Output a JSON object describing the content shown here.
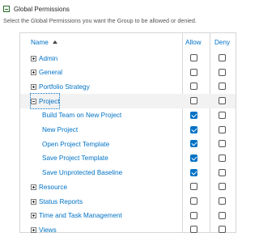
{
  "section": {
    "title": "Global Permissions",
    "description": "Select the Global Permissions you want the Group to be allowed or denied."
  },
  "table": {
    "columns": {
      "name": "Name",
      "allow": "Allow",
      "deny": "Deny"
    },
    "rows": [
      {
        "label": "Admin",
        "level": 0,
        "toggle": "plus",
        "allow": false,
        "deny": false
      },
      {
        "label": "General",
        "level": 0,
        "toggle": "plus",
        "allow": false,
        "deny": false
      },
      {
        "label": "Portfolio Strategy",
        "level": 0,
        "toggle": "plus",
        "allow": false,
        "deny": false
      },
      {
        "label": "Project",
        "level": 0,
        "toggle": "minus",
        "allow": false,
        "deny": false,
        "selected": true
      },
      {
        "label": "Build Team on New Project",
        "level": 1,
        "allow": true,
        "deny": false
      },
      {
        "label": "New Project",
        "level": 1,
        "allow": true,
        "deny": false
      },
      {
        "label": "Open Project Template",
        "level": 1,
        "allow": true,
        "deny": false
      },
      {
        "label": "Save Project Template",
        "level": 1,
        "allow": true,
        "deny": false
      },
      {
        "label": "Save Unprotected Baseline",
        "level": 1,
        "allow": true,
        "deny": false
      },
      {
        "label": "Resource",
        "level": 0,
        "toggle": "plus",
        "allow": false,
        "deny": false
      },
      {
        "label": "Status Reports",
        "level": 0,
        "toggle": "plus",
        "allow": false,
        "deny": false
      },
      {
        "label": "Time and Task Management",
        "level": 0,
        "toggle": "plus",
        "allow": false,
        "deny": false
      },
      {
        "label": "Views",
        "level": 0,
        "toggle": "plus",
        "allow": false,
        "deny": false
      }
    ]
  }
}
